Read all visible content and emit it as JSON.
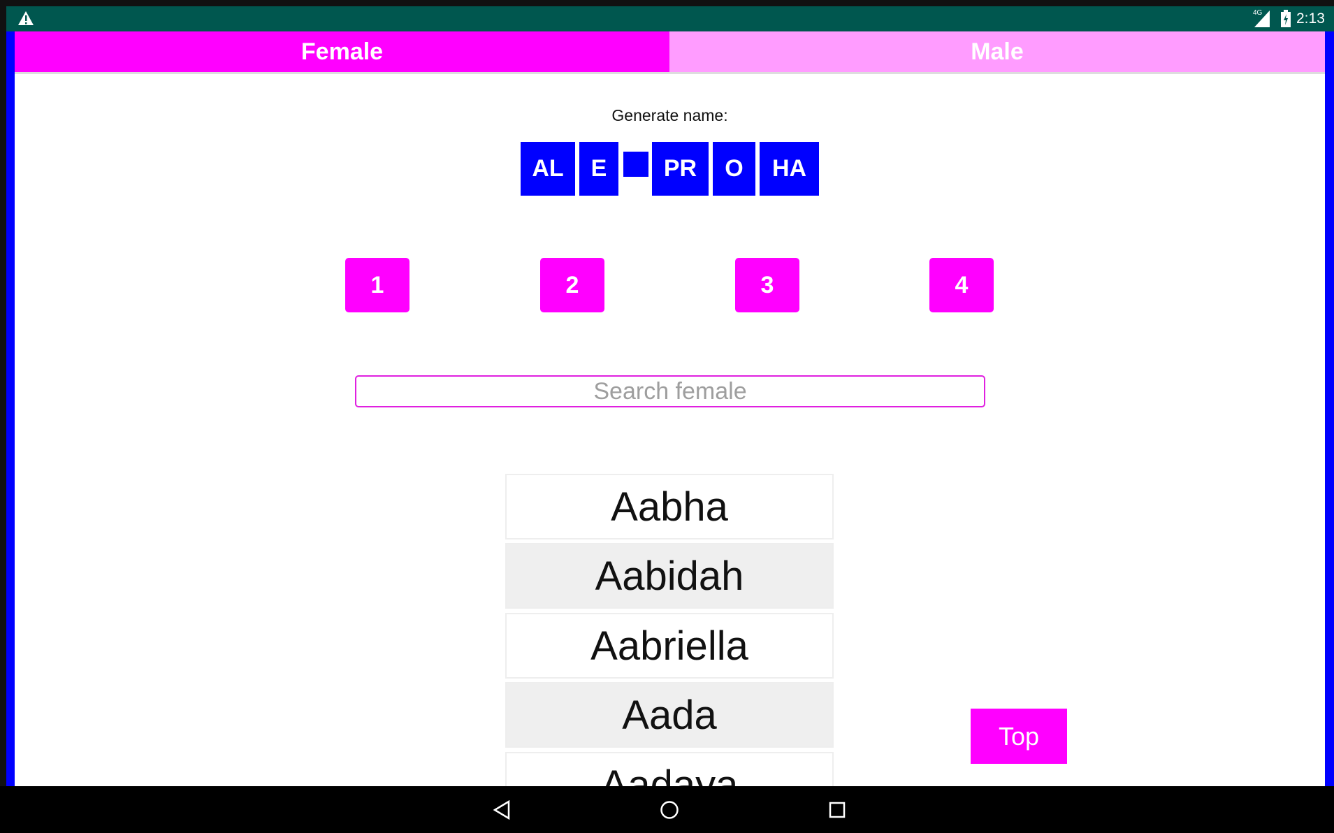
{
  "status_bar": {
    "warning_icon": "warning-triangle-icon",
    "network": "4G",
    "time": "2:13"
  },
  "tabs": [
    {
      "label": "Female",
      "selected": true,
      "color": "#ff00ff"
    },
    {
      "label": "Male",
      "selected": false,
      "color": "#ff9cff"
    }
  ],
  "generator": {
    "label": "Generate name:",
    "syllables": [
      "AL",
      "E",
      "",
      "PR",
      "O",
      "HA"
    ]
  },
  "number_buttons": [
    "1",
    "2",
    "3",
    "4"
  ],
  "search": {
    "placeholder": "Search female",
    "value": ""
  },
  "names": [
    "Aabha",
    "Aabidah",
    "Aabriella",
    "Aada",
    "Aadaya"
  ],
  "top_button": "Top",
  "colors": {
    "accent": "#ff00ff",
    "block": "#0000ff",
    "status": "#00574f"
  }
}
